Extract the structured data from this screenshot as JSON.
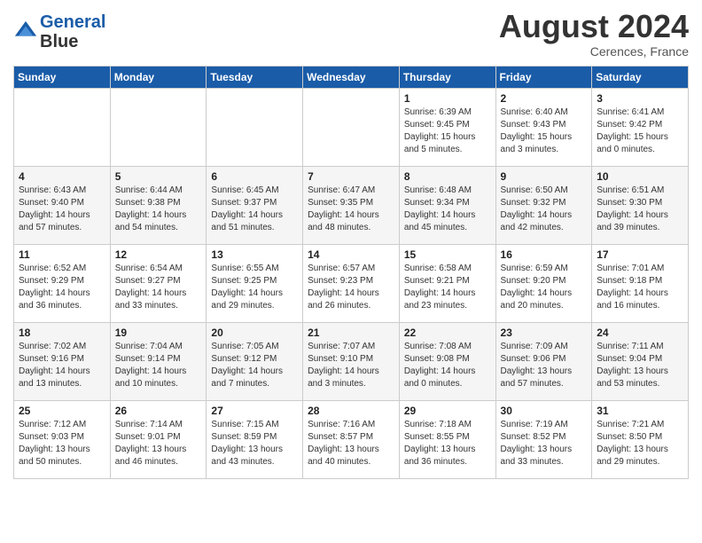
{
  "header": {
    "logo_line1": "General",
    "logo_line2": "Blue",
    "month_year": "August 2024",
    "location": "Cerences, France"
  },
  "weekdays": [
    "Sunday",
    "Monday",
    "Tuesday",
    "Wednesday",
    "Thursday",
    "Friday",
    "Saturday"
  ],
  "weeks": [
    [
      {
        "day": "",
        "info": ""
      },
      {
        "day": "",
        "info": ""
      },
      {
        "day": "",
        "info": ""
      },
      {
        "day": "",
        "info": ""
      },
      {
        "day": "1",
        "info": "Sunrise: 6:39 AM\nSunset: 9:45 PM\nDaylight: 15 hours\nand 5 minutes."
      },
      {
        "day": "2",
        "info": "Sunrise: 6:40 AM\nSunset: 9:43 PM\nDaylight: 15 hours\nand 3 minutes."
      },
      {
        "day": "3",
        "info": "Sunrise: 6:41 AM\nSunset: 9:42 PM\nDaylight: 15 hours\nand 0 minutes."
      }
    ],
    [
      {
        "day": "4",
        "info": "Sunrise: 6:43 AM\nSunset: 9:40 PM\nDaylight: 14 hours\nand 57 minutes."
      },
      {
        "day": "5",
        "info": "Sunrise: 6:44 AM\nSunset: 9:38 PM\nDaylight: 14 hours\nand 54 minutes."
      },
      {
        "day": "6",
        "info": "Sunrise: 6:45 AM\nSunset: 9:37 PM\nDaylight: 14 hours\nand 51 minutes."
      },
      {
        "day": "7",
        "info": "Sunrise: 6:47 AM\nSunset: 9:35 PM\nDaylight: 14 hours\nand 48 minutes."
      },
      {
        "day": "8",
        "info": "Sunrise: 6:48 AM\nSunset: 9:34 PM\nDaylight: 14 hours\nand 45 minutes."
      },
      {
        "day": "9",
        "info": "Sunrise: 6:50 AM\nSunset: 9:32 PM\nDaylight: 14 hours\nand 42 minutes."
      },
      {
        "day": "10",
        "info": "Sunrise: 6:51 AM\nSunset: 9:30 PM\nDaylight: 14 hours\nand 39 minutes."
      }
    ],
    [
      {
        "day": "11",
        "info": "Sunrise: 6:52 AM\nSunset: 9:29 PM\nDaylight: 14 hours\nand 36 minutes."
      },
      {
        "day": "12",
        "info": "Sunrise: 6:54 AM\nSunset: 9:27 PM\nDaylight: 14 hours\nand 33 minutes."
      },
      {
        "day": "13",
        "info": "Sunrise: 6:55 AM\nSunset: 9:25 PM\nDaylight: 14 hours\nand 29 minutes."
      },
      {
        "day": "14",
        "info": "Sunrise: 6:57 AM\nSunset: 9:23 PM\nDaylight: 14 hours\nand 26 minutes."
      },
      {
        "day": "15",
        "info": "Sunrise: 6:58 AM\nSunset: 9:21 PM\nDaylight: 14 hours\nand 23 minutes."
      },
      {
        "day": "16",
        "info": "Sunrise: 6:59 AM\nSunset: 9:20 PM\nDaylight: 14 hours\nand 20 minutes."
      },
      {
        "day": "17",
        "info": "Sunrise: 7:01 AM\nSunset: 9:18 PM\nDaylight: 14 hours\nand 16 minutes."
      }
    ],
    [
      {
        "day": "18",
        "info": "Sunrise: 7:02 AM\nSunset: 9:16 PM\nDaylight: 14 hours\nand 13 minutes."
      },
      {
        "day": "19",
        "info": "Sunrise: 7:04 AM\nSunset: 9:14 PM\nDaylight: 14 hours\nand 10 minutes."
      },
      {
        "day": "20",
        "info": "Sunrise: 7:05 AM\nSunset: 9:12 PM\nDaylight: 14 hours\nand 7 minutes."
      },
      {
        "day": "21",
        "info": "Sunrise: 7:07 AM\nSunset: 9:10 PM\nDaylight: 14 hours\nand 3 minutes."
      },
      {
        "day": "22",
        "info": "Sunrise: 7:08 AM\nSunset: 9:08 PM\nDaylight: 14 hours\nand 0 minutes."
      },
      {
        "day": "23",
        "info": "Sunrise: 7:09 AM\nSunset: 9:06 PM\nDaylight: 13 hours\nand 57 minutes."
      },
      {
        "day": "24",
        "info": "Sunrise: 7:11 AM\nSunset: 9:04 PM\nDaylight: 13 hours\nand 53 minutes."
      }
    ],
    [
      {
        "day": "25",
        "info": "Sunrise: 7:12 AM\nSunset: 9:03 PM\nDaylight: 13 hours\nand 50 minutes."
      },
      {
        "day": "26",
        "info": "Sunrise: 7:14 AM\nSunset: 9:01 PM\nDaylight: 13 hours\nand 46 minutes."
      },
      {
        "day": "27",
        "info": "Sunrise: 7:15 AM\nSunset: 8:59 PM\nDaylight: 13 hours\nand 43 minutes."
      },
      {
        "day": "28",
        "info": "Sunrise: 7:16 AM\nSunset: 8:57 PM\nDaylight: 13 hours\nand 40 minutes."
      },
      {
        "day": "29",
        "info": "Sunrise: 7:18 AM\nSunset: 8:55 PM\nDaylight: 13 hours\nand 36 minutes."
      },
      {
        "day": "30",
        "info": "Sunrise: 7:19 AM\nSunset: 8:52 PM\nDaylight: 13 hours\nand 33 minutes."
      },
      {
        "day": "31",
        "info": "Sunrise: 7:21 AM\nSunset: 8:50 PM\nDaylight: 13 hours\nand 29 minutes."
      }
    ]
  ]
}
